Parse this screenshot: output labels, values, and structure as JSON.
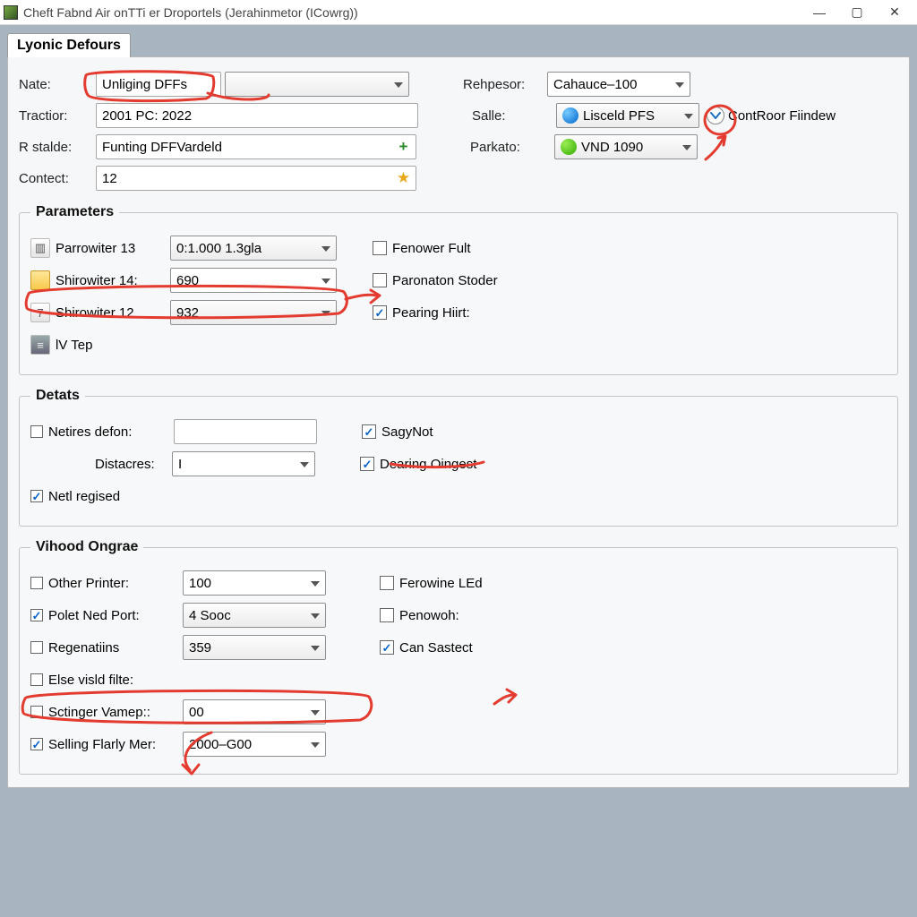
{
  "window": {
    "title": "Cheft Fabnd Air onTTi er Droportels  (Jerahinmetor (ICowrg))"
  },
  "tab": {
    "label": "Lyonic Defours"
  },
  "header": {
    "nate_label": "Nate:",
    "nate_value": "Unliging DFFs",
    "tractior_label": "Tractior:",
    "tractior_value": "2001 PC: 2022",
    "rstalde_label": "R stalde:",
    "rstalde_value": "Funting DFFVardeld",
    "contect_label": "Contect:",
    "contect_value": "12",
    "rehpesor_label": "Rehpesor:",
    "rehpesor_value": "Cahauce–100",
    "salle_label": "Salle:",
    "salle_value": "Lisceld PFS",
    "parkato_label": "Parkato:",
    "parkato_value": "VND 1090",
    "controor_label": "ContRoor Fiindew"
  },
  "parameters": {
    "legend": "Parameters",
    "p1_label": "Parrowiter 13",
    "p1_value": "0:1.000 1.3gla",
    "p2_label": "Shirowiter 14:",
    "p2_value": "690",
    "p3_label": "Shirowiter 12",
    "p3_value": "932",
    "lv_label": "lV Tep",
    "cb1": "Fenower Fult",
    "cb2": "Paronaton Stoder",
    "cb3": "Pearing Hiirt:"
  },
  "detats": {
    "legend": "Detats",
    "netires_label": "Netires defon:",
    "distacres_label": "Distacres:",
    "distacres_value": "I",
    "netl_label": "Netl regised",
    "sagy_label": "SagyNot",
    "dearing_label": "Dearing Oingest"
  },
  "vihood": {
    "legend": "Vihood Ongrae",
    "other_label": "Other Printer:",
    "other_value": "100",
    "polet_label": "Polet Ned Port:",
    "polet_value": "4 Sooc",
    "regen_label": "Regenatiins",
    "regen_value": "359",
    "else_label": "Else visld filte:",
    "scunger_label": "Sctinger Vamep::",
    "scunger_value": "00",
    "selling_label": "Selling Flarly Mer:",
    "selling_value": "2000–G00",
    "ferowine_label": "Ferowine LEd",
    "penowoh_label": "Penowoh:",
    "cansastect_label": "Can Sastect"
  }
}
